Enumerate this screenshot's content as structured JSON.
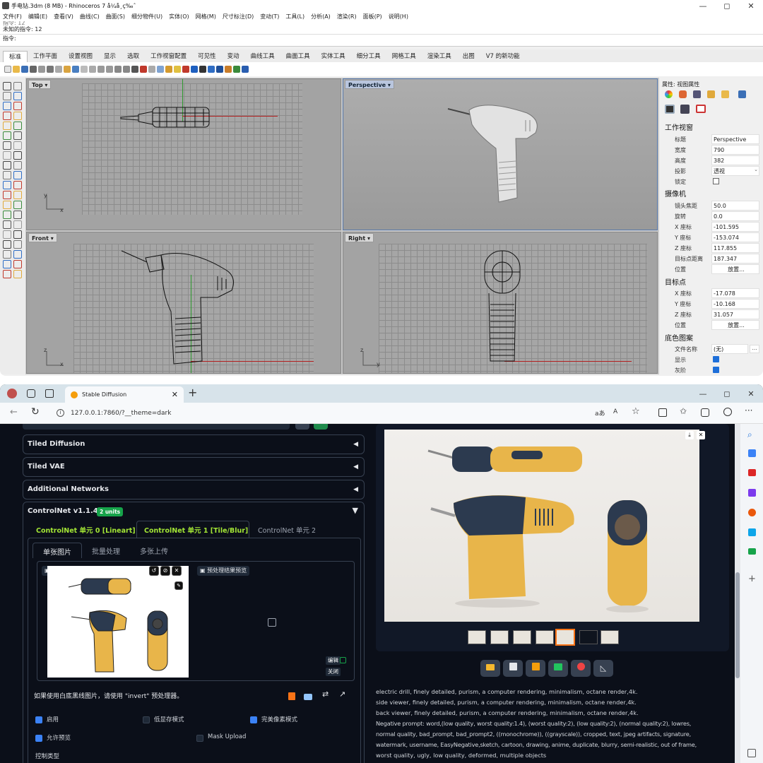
{
  "rhino": {
    "title": "手电钻.3dm (8 MB) - Rhinoceros 7 å¼å¸ç‰ˆ",
    "window_controls": [
      "—",
      "◻",
      "✕"
    ],
    "menu": [
      "文件(F)",
      "编辑(E)",
      "查看(V)",
      "曲线(C)",
      "曲面(S)",
      "细分物件(U)",
      "实体(O)",
      "网格(M)",
      "尺寸标注(D)",
      "变动(T)",
      "工具(L)",
      "分析(A)",
      "渲染(R)",
      "面板(P)",
      "说明(H)"
    ],
    "command_history": [
      "指令: 12",
      "未知的指令: 12"
    ],
    "command_prompt": "指令:",
    "tabs": [
      "标准",
      "工作平面",
      "设置视图",
      "显示",
      "选取",
      "工作视窗配置",
      "可见性",
      "变动",
      "曲线工具",
      "曲面工具",
      "实体工具",
      "细分工具",
      "网格工具",
      "渲染工具",
      "出图",
      "V7 的新功能"
    ],
    "viewports": {
      "top": {
        "label": "Top",
        "axis_x": "x",
        "axis_y": "y"
      },
      "perspective": {
        "label": "Perspective"
      },
      "front": {
        "label": "Front",
        "axis_x": "x",
        "axis_y": "z"
      },
      "right": {
        "label": "Right",
        "axis_x": "y",
        "axis_y": "z"
      }
    },
    "properties": {
      "header": "属性: 视图属性",
      "section_viewport": "工作视窗",
      "viewport_rows": [
        {
          "key": "标题",
          "value": "Perspective"
        },
        {
          "key": "宽度",
          "value": "790"
        },
        {
          "key": "高度",
          "value": "382"
        },
        {
          "key": "投影",
          "value": "透视"
        },
        {
          "key": "锁定",
          "value": ""
        }
      ],
      "section_camera": "摄像机",
      "camera_rows": [
        {
          "key": "镜头焦距",
          "value": "50.0"
        },
        {
          "key": "旋转",
          "value": "0.0"
        },
        {
          "key": "X 座标",
          "value": "-101.595"
        },
        {
          "key": "Y 座标",
          "value": "-153.074"
        },
        {
          "key": "Z 座标",
          "value": "117.855"
        },
        {
          "key": "目标点距离",
          "value": "187.347"
        },
        {
          "key": "位置",
          "value": "放置..."
        }
      ],
      "section_target": "目标点",
      "target_rows": [
        {
          "key": "X 座标",
          "value": "-17.078"
        },
        {
          "key": "Y 座标",
          "value": "-10.168"
        },
        {
          "key": "Z 座标",
          "value": "31.057"
        },
        {
          "key": "位置",
          "value": "放置..."
        }
      ],
      "section_background": "底色图案",
      "background_rows": [
        {
          "key": "文件名称",
          "value": "(无)"
        },
        {
          "key": "显示",
          "value": ""
        },
        {
          "key": "灰阶",
          "value": ""
        }
      ]
    }
  },
  "browser": {
    "tab_title": "Stable Diffusion",
    "new_tab": "+",
    "url": "127.0.0.1:7860/?__theme=dark",
    "window_controls": [
      "—",
      "◻",
      "✕"
    ],
    "accordions": [
      "Tiled Diffusion",
      "Tiled VAE",
      "Additional Networks"
    ],
    "controlnet": {
      "title": "ControlNet v1.1.440",
      "badge": "2 units",
      "unit_tabs": [
        "ControlNet 单元 0 [Lineart]",
        "ControlNet 单元 1 [Tile/Blur]",
        "ControlNet 单元 2"
      ],
      "sub_tabs": [
        "单张图片",
        "批量处理",
        "多张上传"
      ],
      "image_label": "图像",
      "preprocess_label": "预处理结果预览",
      "edit_label": "编辑",
      "close_label": "关闭",
      "hint": "如果使用白底黑线图片，请使用 \"invert\" 预处理器。",
      "options": [
        {
          "label": "启用",
          "checked": true
        },
        {
          "label": "低显存模式",
          "checked": false
        },
        {
          "label": "完美像素模式",
          "checked": true
        },
        {
          "label": "允许预览",
          "checked": true
        },
        {
          "label": "Mask Upload",
          "checked": false
        }
      ],
      "control_type": "控制类型"
    },
    "prompt_lines": [
      "electric drill, finely detailed, purism, a computer rendering, minimalism, octane render,4k.",
      "side viewer, finely detailed, purism, a computer rendering, minimalism, octane render,4k.",
      "back viewer, finely detailed, purism, a computer rendering, minimalism, octane render,4k.",
      "Negative prompt: word,(low quality, worst quality:1.4), (worst quality:2), (low quality:2), (normal quality:2), lowres,",
      "normal quality, bad_prompt, bad_prompt2, ((monochrome)), ((grayscale)), cropped, text, jpeg artifacts, signature,",
      "watermark, username, EasyNegative,sketch, cartoon, drawing, anime, duplicate, blurry, semi-realistic, out of frame,",
      "worst quality, ugly, low quality, deformed, multiple objects"
    ]
  },
  "colors": {
    "accent_green": "#16a34a",
    "selected_tab_text": "#a3e635",
    "check_blue": "#3b82f6",
    "thumb_selected": "#f97316",
    "drill_yellow": "#e8b54a",
    "drill_navy": "#2c3a4f"
  }
}
